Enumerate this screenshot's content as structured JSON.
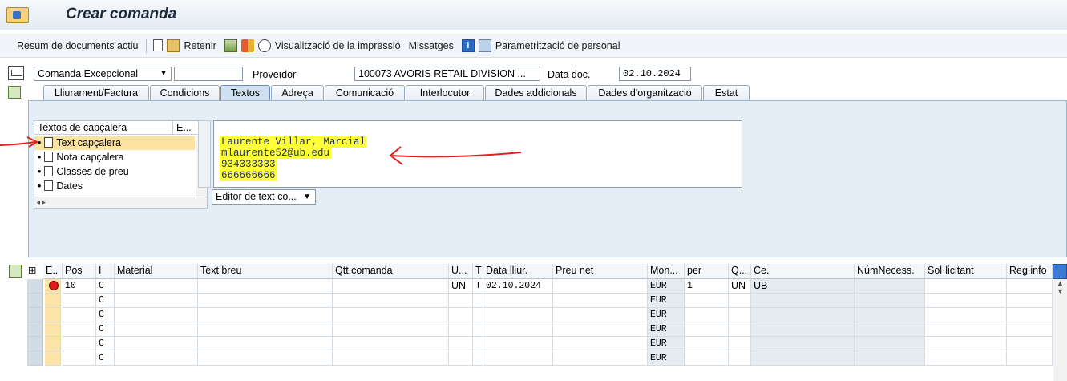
{
  "title": "Crear comanda",
  "toolbar": {
    "items": [
      {
        "label": "Resum de documents actiu"
      },
      {
        "label": "Retenir"
      },
      {
        "label": "Visualització de la impressió"
      },
      {
        "label": "Missatges"
      },
      {
        "label": "Parametrització de personal"
      }
    ]
  },
  "header": {
    "order_type": "Comanda Excepcional",
    "order_number": "",
    "vendor_label": "Proveïdor",
    "vendor_value": "100073 AVORIS RETAIL DIVISION ...",
    "date_label": "Data doc.",
    "date_value": "02.10.2024"
  },
  "tabs": [
    "Lliurament/Factura",
    "Condicions",
    "Textos",
    "Adreça",
    "Comunicació",
    "Interlocutor",
    "Dades addicionals",
    "Dades d'organització",
    "Estat"
  ],
  "active_tab": "Textos",
  "text_tree": {
    "col1": "Textos de capçalera",
    "col2": "E...",
    "items": [
      "Text capçalera",
      "Nota capçalera",
      "Classes de preu",
      "Dates"
    ],
    "selected": "Text capçalera"
  },
  "editor": {
    "lines": [
      "Laurente Villar, Marcial",
      "mlaurente52@ub.edu",
      "934333333",
      "666666666"
    ],
    "mode": "Editor de text co..."
  },
  "grid": {
    "columns": [
      "E..",
      "Pos",
      "I",
      "Material",
      "Text breu",
      "Qtt.comanda",
      "U...",
      "T",
      "Data lliur.",
      "Preu net",
      "Mon...",
      "per",
      "Q...",
      "Ce.",
      "NúmNecess.",
      "Sol·licitant",
      "Reg.info"
    ],
    "rows": [
      {
        "pos": "10",
        "i": "C",
        "unit": "UN",
        "t": "T",
        "date": "02.10.2024",
        "cur": "EUR",
        "per": "1",
        "q": "UN",
        "ce": "UB"
      },
      {
        "pos": "",
        "i": "C",
        "unit": "",
        "t": "",
        "date": "",
        "cur": "EUR",
        "per": "",
        "q": "",
        "ce": ""
      },
      {
        "pos": "",
        "i": "C",
        "unit": "",
        "t": "",
        "date": "",
        "cur": "EUR",
        "per": "",
        "q": "",
        "ce": ""
      },
      {
        "pos": "",
        "i": "C",
        "unit": "",
        "t": "",
        "date": "",
        "cur": "EUR",
        "per": "",
        "q": "",
        "ce": ""
      },
      {
        "pos": "",
        "i": "C",
        "unit": "",
        "t": "",
        "date": "",
        "cur": "EUR",
        "per": "",
        "q": "",
        "ce": ""
      },
      {
        "pos": "",
        "i": "C",
        "unit": "",
        "t": "",
        "date": "",
        "cur": "EUR",
        "per": "",
        "q": "",
        "ce": ""
      }
    ]
  },
  "colors": {
    "annotation": "#e0201c",
    "highlight": "#ffff3b"
  }
}
